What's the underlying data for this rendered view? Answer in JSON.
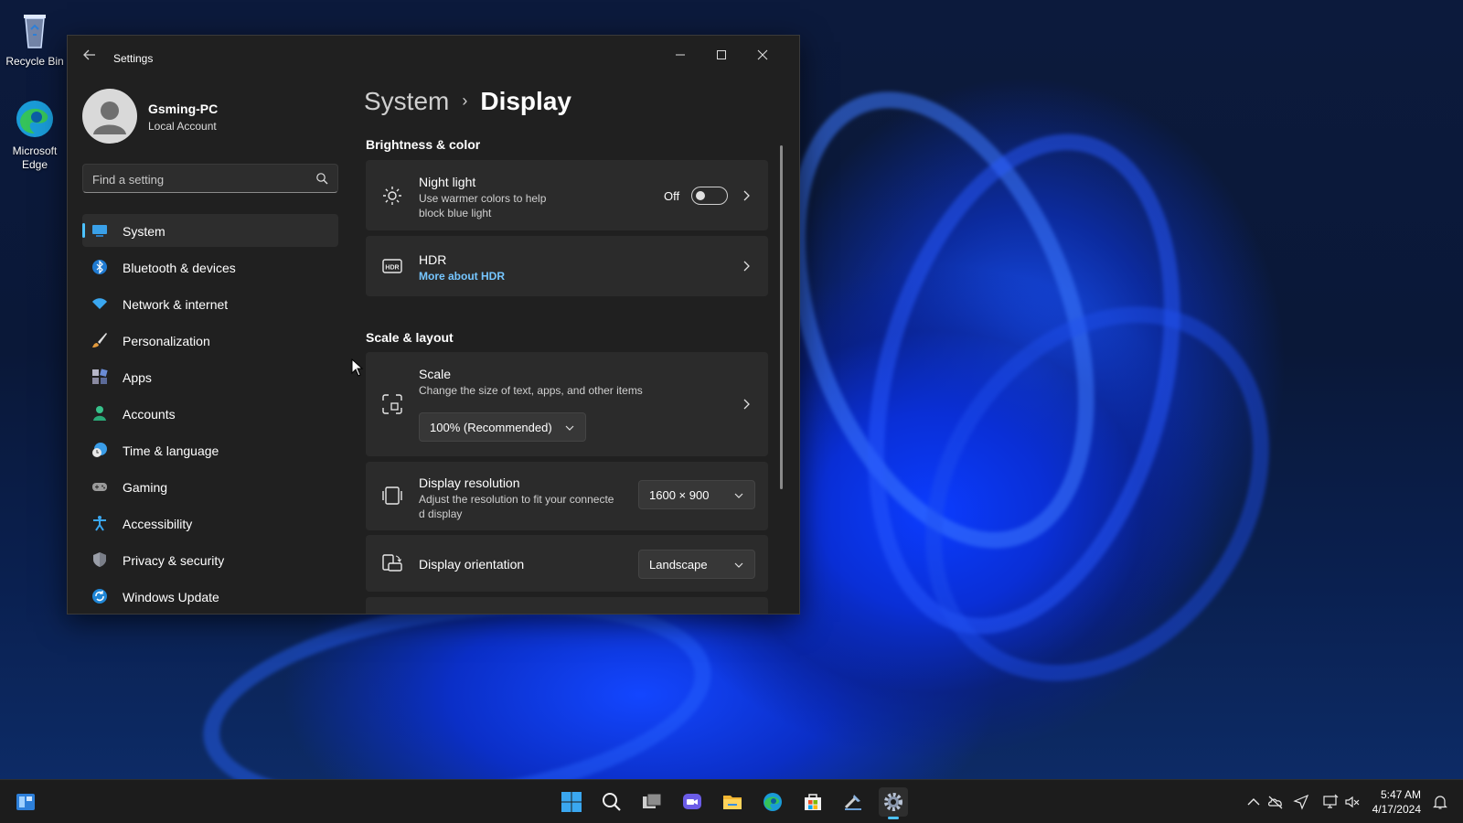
{
  "desktop": {
    "icons": [
      {
        "label": "Recycle Bin",
        "icon": "recycle-bin-icon"
      },
      {
        "label": "Microsoft Edge",
        "icon": "edge-icon"
      }
    ]
  },
  "window": {
    "title": "Settings",
    "controls": {
      "minimize": "minimize-icon",
      "maximize": "maximize-icon",
      "close": "close-icon"
    }
  },
  "account": {
    "name": "Gsming-PC",
    "type": "Local Account"
  },
  "search": {
    "placeholder": "Find a setting"
  },
  "nav": {
    "items": [
      {
        "label": "System",
        "icon": "system-icon",
        "active": true
      },
      {
        "label": "Bluetooth & devices",
        "icon": "bluetooth-icon"
      },
      {
        "label": "Network & internet",
        "icon": "wifi-icon"
      },
      {
        "label": "Personalization",
        "icon": "brush-icon"
      },
      {
        "label": "Apps",
        "icon": "apps-icon"
      },
      {
        "label": "Accounts",
        "icon": "accounts-icon"
      },
      {
        "label": "Time & language",
        "icon": "time-language-icon"
      },
      {
        "label": "Gaming",
        "icon": "gamepad-icon"
      },
      {
        "label": "Accessibility",
        "icon": "accessibility-icon"
      },
      {
        "label": "Privacy & security",
        "icon": "shield-icon"
      },
      {
        "label": "Windows Update",
        "icon": "windows-update-icon"
      }
    ]
  },
  "breadcrumb": {
    "parent": "System",
    "current": "Display"
  },
  "sections": {
    "brightness": {
      "heading": "Brightness & color",
      "night_light": {
        "title": "Night light",
        "subtitle_line1": "Use warmer colors to help",
        "subtitle_line2": "block blue light",
        "toggle_state": "Off"
      },
      "hdr": {
        "title": "HDR",
        "link": "More about HDR"
      }
    },
    "scale_layout": {
      "heading": "Scale & layout",
      "scale": {
        "title": "Scale",
        "subtitle": "Change the size of text, apps, and other items",
        "value": "100% (Recommended)"
      },
      "resolution": {
        "title": "Display resolution",
        "subtitle_line1": "Adjust the resolution to fit your connecte",
        "subtitle_line2": "d display",
        "value": "1600 × 900"
      },
      "orientation": {
        "title": "Display orientation",
        "value": "Landscape"
      }
    }
  },
  "taskbar": {
    "pinned": [
      "start-icon",
      "search-icon",
      "task-view-icon",
      "chat-icon",
      "file-explorer-icon",
      "edge-icon",
      "store-icon",
      "tool-icon",
      "settings-icon"
    ],
    "clock": {
      "time": "5:47 AM",
      "date": "4/17/2024"
    }
  },
  "colors": {
    "accent": "#4cc2ff",
    "link": "#76c6ff",
    "window_bg": "#202020",
    "card_bg": "#2b2b2b"
  }
}
